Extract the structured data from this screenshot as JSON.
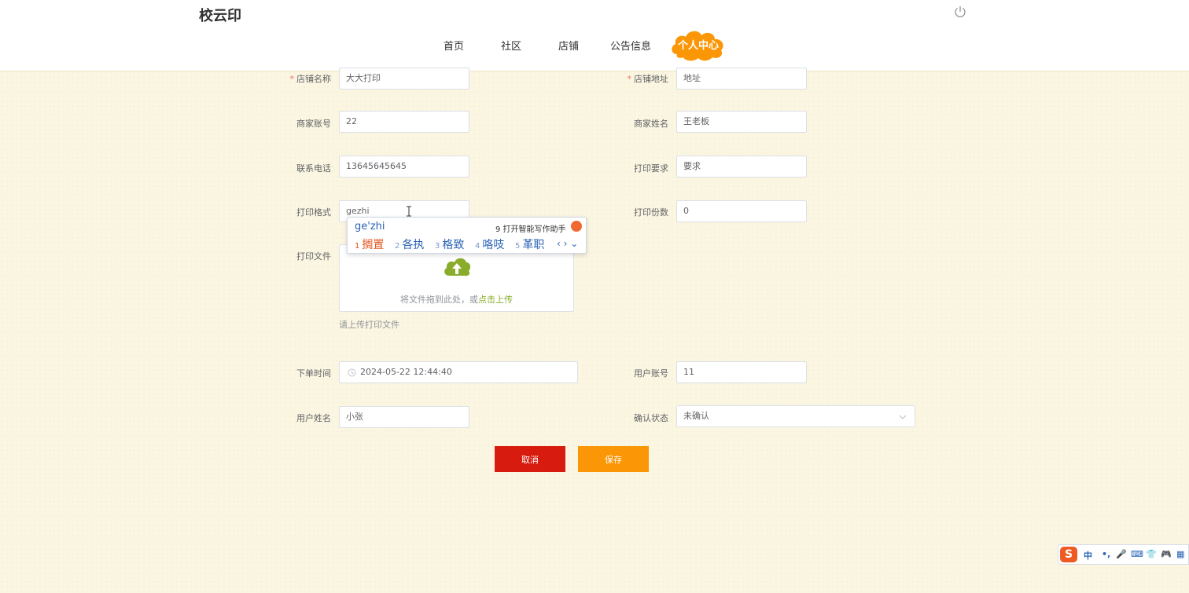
{
  "app": {
    "title": "校云印"
  },
  "nav": {
    "items": [
      "首页",
      "社区",
      "店铺",
      "公告信息"
    ],
    "active": "个人中心"
  },
  "form": {
    "shop_name": {
      "label": "店铺名称",
      "value": "大大打印",
      "required": true
    },
    "shop_address": {
      "label": "店铺地址",
      "value": "地址",
      "required": true
    },
    "merchant_account": {
      "label": "商家账号",
      "value": "22"
    },
    "merchant_name": {
      "label": "商家姓名",
      "value": "王老板"
    },
    "phone": {
      "label": "联系电话",
      "value": "13645645645"
    },
    "print_requirement": {
      "label": "打印要求",
      "value": "要求"
    },
    "print_format": {
      "label": "打印格式",
      "value": "gezhi"
    },
    "print_copies": {
      "label": "打印份数",
      "value": "0"
    },
    "print_file": {
      "label": "打印文件",
      "drop_text": "将文件拖到此处，或",
      "click_text": "点击上传",
      "tip": "请上传打印文件"
    },
    "order_time": {
      "label": "下单时间",
      "value": "2024-05-22 12:44:40"
    },
    "user_account": {
      "label": "用户账号",
      "value": "11"
    },
    "user_name": {
      "label": "用户姓名",
      "value": "小张"
    },
    "confirm_status": {
      "label": "确认状态",
      "value": "未确认"
    },
    "required_mark": "*"
  },
  "buttons": {
    "cancel": "取消",
    "save": "保存"
  },
  "ime": {
    "composition": "ge'zhi",
    "hint": "9 打开智能写作助手",
    "candidates": [
      {
        "num": "1",
        "text": "搁置"
      },
      {
        "num": "2",
        "text": "各执"
      },
      {
        "num": "3",
        "text": "格致"
      },
      {
        "num": "4",
        "text": "咯吱"
      },
      {
        "num": "5",
        "text": "革职"
      }
    ],
    "nav": "‹ › ⌄"
  },
  "sogou_bar": {
    "items": [
      "中",
      "•,",
      "🎤",
      "⌨",
      "👕",
      "🎮",
      "▦"
    ],
    "logo": "S"
  },
  "colors": {
    "accent": "#fb9707",
    "danger": "#d71b0e",
    "upload_icon": "#8aac2b",
    "background": "#fbf6e2"
  }
}
